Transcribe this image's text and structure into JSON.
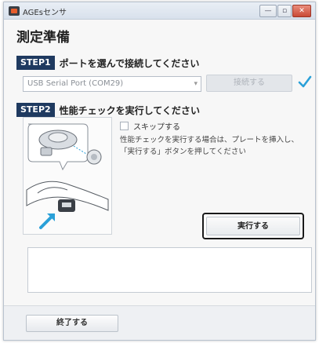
{
  "window": {
    "title": "AGEsセンサ",
    "min_label": "—",
    "max_label": "▫",
    "close_label": "✕"
  },
  "page": {
    "title": "測定準備"
  },
  "step1": {
    "badge": "STEP1",
    "text": "ポートを選んで接続してください",
    "port_value": "USB Serial Port (COM29)",
    "connect_label": "接続する",
    "connected_icon": "check-icon",
    "check_color": "#2aa0d8"
  },
  "step2": {
    "badge": "STEP2",
    "text": "性能チェックを実行してください",
    "skip_label": "スキップする",
    "description_line1": "性能チェックを実行する場合は、プレートを挿入し、",
    "description_line2": "「実行する」ボタンを押してください",
    "run_label": "実行する"
  },
  "footer": {
    "exit_label": "終了する"
  },
  "colors": {
    "step_badge": "#1f3a60",
    "arrow_accent": "#2aa0d8"
  }
}
